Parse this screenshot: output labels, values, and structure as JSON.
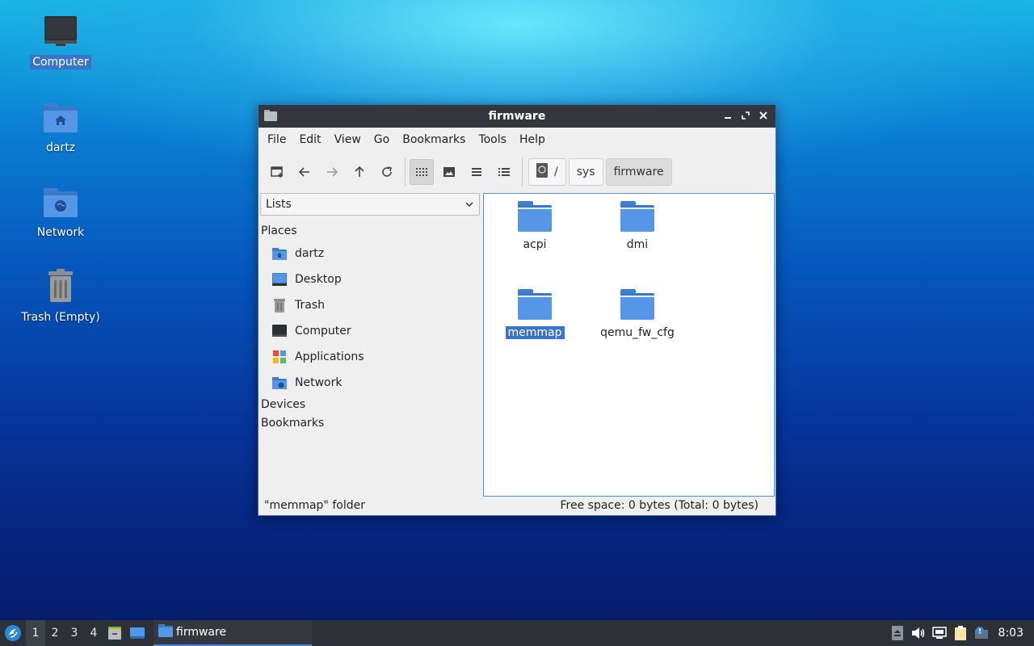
{
  "desktop": {
    "icons": [
      {
        "label": "Computer"
      },
      {
        "label": "dartz"
      },
      {
        "label": "Network"
      },
      {
        "label": "Trash (Empty)"
      }
    ]
  },
  "window": {
    "title": "firmware",
    "menu": [
      "File",
      "Edit",
      "View",
      "Go",
      "Bookmarks",
      "Tools",
      "Help"
    ],
    "toolbar": {
      "buttons": [
        "new-tab-icon",
        "back-icon",
        "forward-icon",
        "up-icon",
        "reload-icon",
        "icon-view-icon",
        "thumbnail-view-icon",
        "compact-view-icon",
        "detailed-list-view-icon"
      ]
    },
    "path": {
      "root": "/",
      "segments": [
        "sys",
        "firmware"
      ]
    },
    "sidebar": {
      "mode": "Lists",
      "sections": {
        "places": "Places",
        "devices": "Devices",
        "bookmarks": "Bookmarks"
      },
      "places": [
        {
          "label": "dartz",
          "icon": "home-folder-icon"
        },
        {
          "label": "Desktop",
          "icon": "desktop-icon"
        },
        {
          "label": "Trash",
          "icon": "trash-icon"
        },
        {
          "label": "Computer",
          "icon": "computer-icon"
        },
        {
          "label": "Applications",
          "icon": "applications-icon"
        },
        {
          "label": "Network",
          "icon": "network-folder-icon"
        }
      ]
    },
    "files": [
      {
        "name": "acpi",
        "selected": false
      },
      {
        "name": "dmi",
        "selected": false
      },
      {
        "name": "memmap",
        "selected": true
      },
      {
        "name": "qemu_fw_cfg",
        "selected": false
      }
    ],
    "status": {
      "left": "\"memmap\" folder",
      "right": "Free space: 0 bytes (Total: 0 bytes)"
    }
  },
  "taskbar": {
    "workspaces": [
      "1",
      "2",
      "3",
      "4"
    ],
    "active_workspace": "1",
    "task": "firmware",
    "clock": "8:03"
  }
}
